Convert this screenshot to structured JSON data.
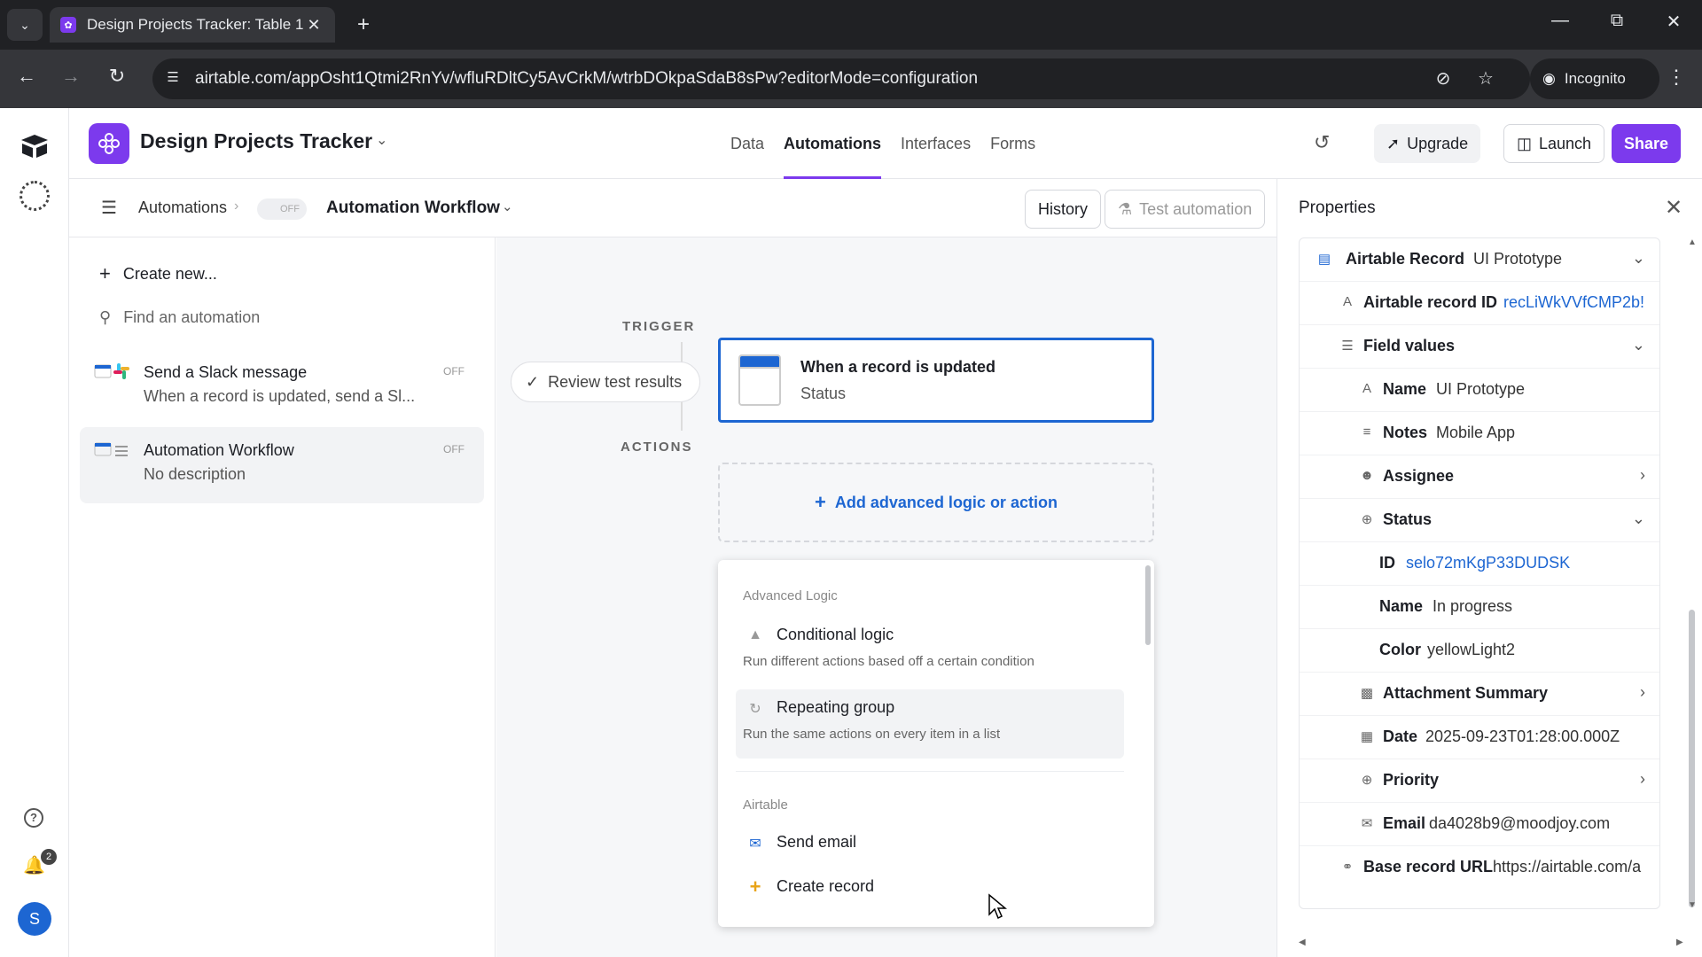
{
  "browser": {
    "tab_title": "Design Projects Tracker: Table 1",
    "url": "airtable.com/appOsht1Qtmi2RnYv/wfluRDltCy5AvCrkM/wtrbDOkpaSdaB8sPw?editorMode=configuration",
    "incognito_label": "Incognito"
  },
  "header": {
    "base_title": "Design Projects Tracker",
    "nav": [
      "Data",
      "Automations",
      "Interfaces",
      "Forms"
    ],
    "active_nav": "Automations",
    "upgrade_label": "Upgrade",
    "launch_label": "Launch",
    "share_label": "Share",
    "accent_color": "#7c3aed"
  },
  "subheader": {
    "breadcrumb_root": "Automations",
    "toggle_label": "OFF",
    "current": "Automation Workflow",
    "history_label": "History",
    "test_label": "Test automation"
  },
  "sidebar": {
    "create_new": "Create new...",
    "search_placeholder": "Find an automation",
    "items": [
      {
        "name": "Send a Slack message",
        "desc": "When a record is updated, send a Sl...",
        "state": "OFF",
        "selected": false
      },
      {
        "name": "Automation Workflow",
        "desc": "No description",
        "state": "OFF",
        "selected": true
      }
    ]
  },
  "rail": {
    "notification_count": "2",
    "avatar_initial": "S"
  },
  "canvas": {
    "trigger_label": "TRIGGER",
    "actions_label": "ACTIONS",
    "review_label": "Review test results",
    "trigger_title": "When a record is updated",
    "trigger_sub": "Status",
    "add_logic_label": "Add advanced logic or action",
    "menu": {
      "section_advanced": "Advanced Logic",
      "conditional_title": "Conditional logic",
      "conditional_desc": "Run different actions based off a certain condition",
      "repeating_title": "Repeating group",
      "repeating_desc": "Run the same actions on every item in a list",
      "section_airtable": "Airtable",
      "send_email": "Send email",
      "create_record": "Create record"
    }
  },
  "properties": {
    "title": "Properties",
    "record_label": "Airtable Record",
    "record_value": "UI Prototype",
    "record_id_label": "Airtable record ID",
    "record_id_value": "recLiWkVVfCMP2b!",
    "field_values_label": "Field values",
    "name_label": "Name",
    "name_value": "UI Prototype",
    "notes_label": "Notes",
    "notes_value": "Mobile App",
    "assignee_label": "Assignee",
    "status_label": "Status",
    "status_id_label": "ID",
    "status_id_value": "selo72mKgP33DUDSK",
    "status_name_label": "Name",
    "status_name_value": "In progress",
    "status_color_label": "Color",
    "status_color_value": "yellowLight2",
    "attachment_label": "Attachment Summary",
    "date_label": "Date",
    "date_value": "2025-09-23T01:28:00.000Z",
    "priority_label": "Priority",
    "email_label": "Email",
    "email_value": "da4028b9@moodjoy.com",
    "base_url_label": "Base record URL",
    "base_url_value": "https://airtable.com/a"
  }
}
